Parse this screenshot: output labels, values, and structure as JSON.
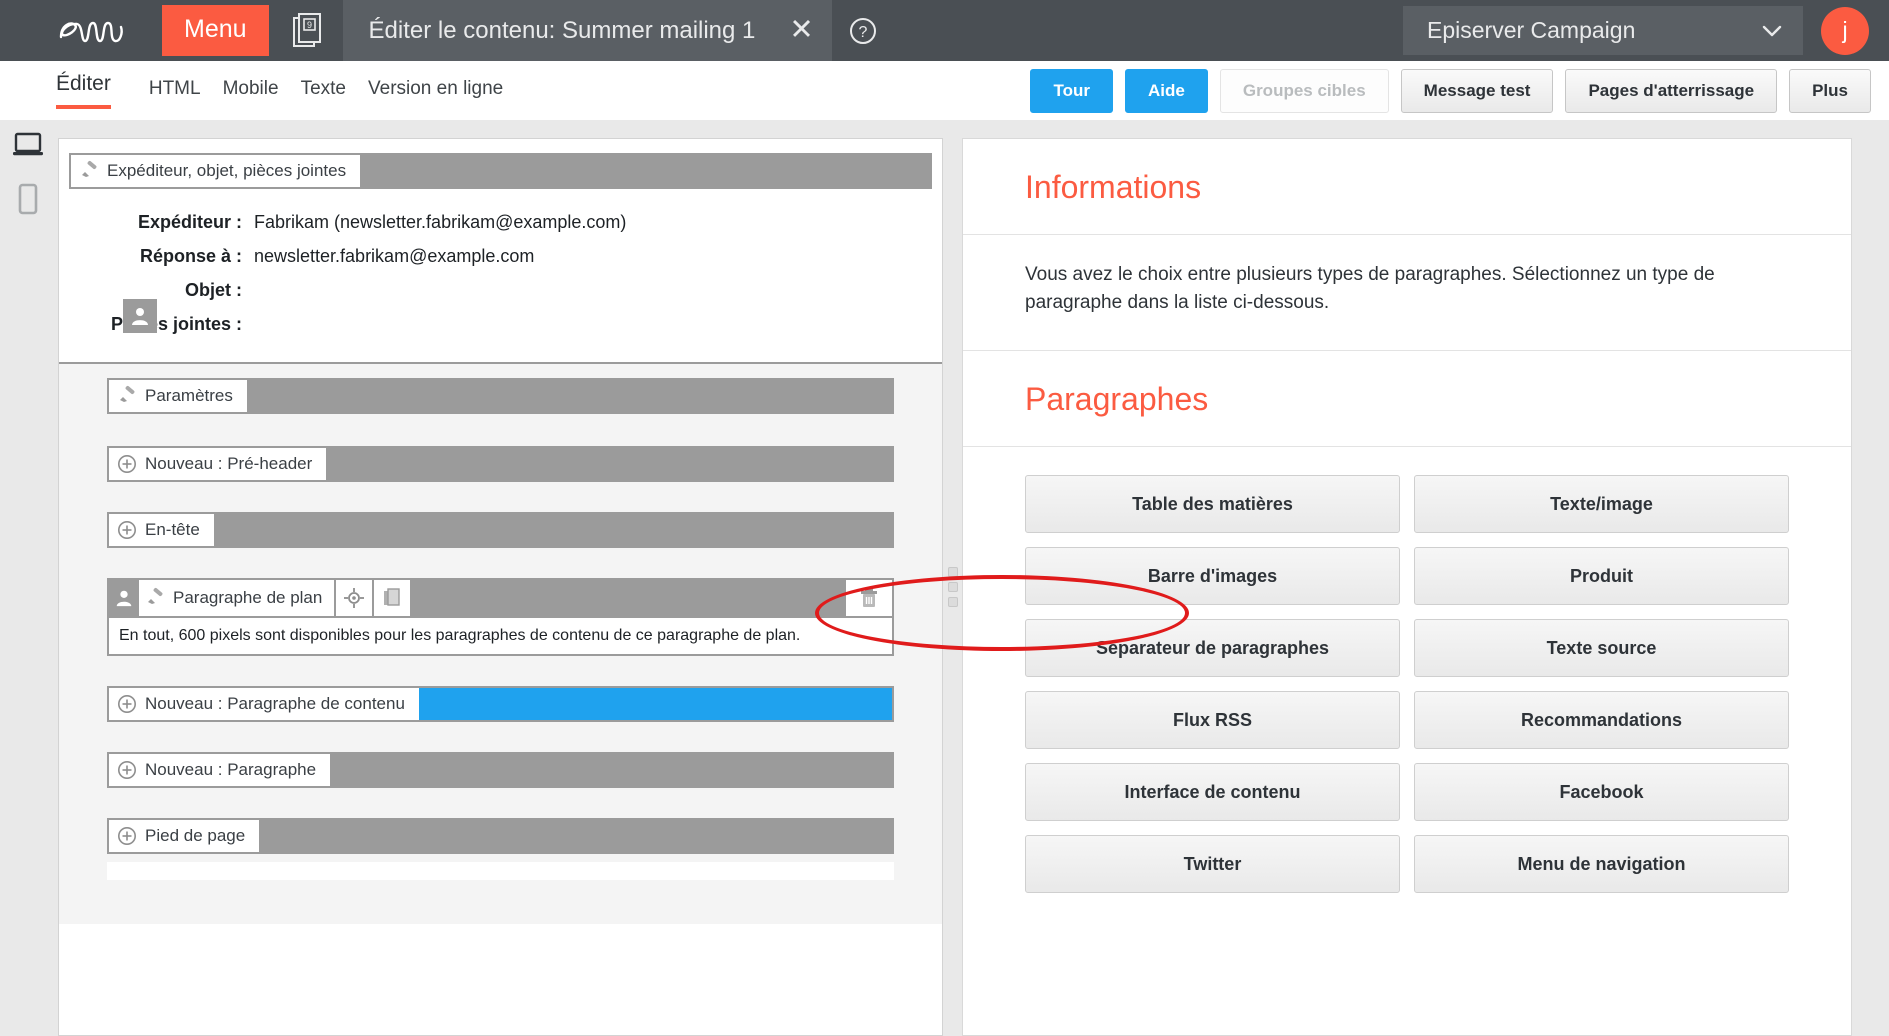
{
  "topbar": {
    "logo_alt": "epi-logo",
    "menu_label": "Menu",
    "doc_badge": "9",
    "tab_title": "Éditer le contenu: Summer mailing 1",
    "close_label": "✕",
    "help_label": "?",
    "org_name": "Episerver Campaign",
    "avatar_initial": "j"
  },
  "viewtabs": [
    {
      "label": "Éditer",
      "active": true
    },
    {
      "label": "HTML",
      "active": false
    },
    {
      "label": "Mobile",
      "active": false
    },
    {
      "label": "Texte",
      "active": false
    },
    {
      "label": "Version en ligne",
      "active": false
    }
  ],
  "actions": [
    {
      "label": "Tour",
      "style": "blue",
      "disabled": false
    },
    {
      "label": "Aide",
      "style": "blue",
      "disabled": false
    },
    {
      "label": "Groupes cibles",
      "style": "grey",
      "disabled": true
    },
    {
      "label": "Message test",
      "style": "grey",
      "disabled": false
    },
    {
      "label": "Pages d'atterrissage",
      "style": "grey",
      "disabled": false
    },
    {
      "label": "Plus",
      "style": "grey",
      "disabled": false
    }
  ],
  "device_rail": [
    {
      "name": "desktop-view",
      "label": "Bureau"
    },
    {
      "name": "mobile-view",
      "label": "Mobile"
    }
  ],
  "editor": {
    "header_section_label": "Expéditeur, objet, pièces jointes",
    "fields": [
      {
        "label": "Expéditeur :",
        "value": "Fabrikam (newsletter.fabrikam@example.com)"
      },
      {
        "label": "Réponse à :",
        "value": "newsletter.fabrikam@example.com"
      },
      {
        "label": "Objet :",
        "value": ""
      },
      {
        "label": "Pièces jointes :",
        "value": ""
      }
    ],
    "settings_label": "Paramètres",
    "rows": [
      {
        "label": "Nouveau : Pré-header",
        "fill": "grey"
      },
      {
        "label": "En-tête",
        "fill": "grey"
      }
    ],
    "plan_block": {
      "label": "Paragraphe de plan",
      "note": "En tout, 600 pixels sont disponibles pour les paragraphes de contenu de ce paragraphe de plan."
    },
    "rows_after": [
      {
        "label": "Nouveau : Paragraphe de contenu",
        "fill": "blue"
      },
      {
        "label": "Nouveau : Paragraphe",
        "fill": "grey"
      },
      {
        "label": "Pied de page",
        "fill": "grey"
      }
    ]
  },
  "right_panel": {
    "info_title": "Informations",
    "info_text": "Vous avez le choix entre plusieurs types de paragraphes. Sélectionnez un type de paragraphe dans la liste ci-dessous.",
    "paragraphs_title": "Paragraphes",
    "paragraph_types": [
      "Table des matières",
      "Texte/image",
      "Barre d'images",
      "Produit",
      "Séparateur de paragraphes",
      "Texte source",
      "Flux RSS",
      "Recommandations",
      "Interface de contenu",
      "Facebook",
      "Twitter",
      "Menu de navigation"
    ],
    "highlighted_item": "Séparateur de paragraphes"
  },
  "colors": {
    "brand_orange": "#fb5b41",
    "topbar_dark": "#4a4f54",
    "accent_blue": "#1fa2ee",
    "annotation_red": "#e01b1b",
    "fill_grey": "#9b9b9b"
  }
}
